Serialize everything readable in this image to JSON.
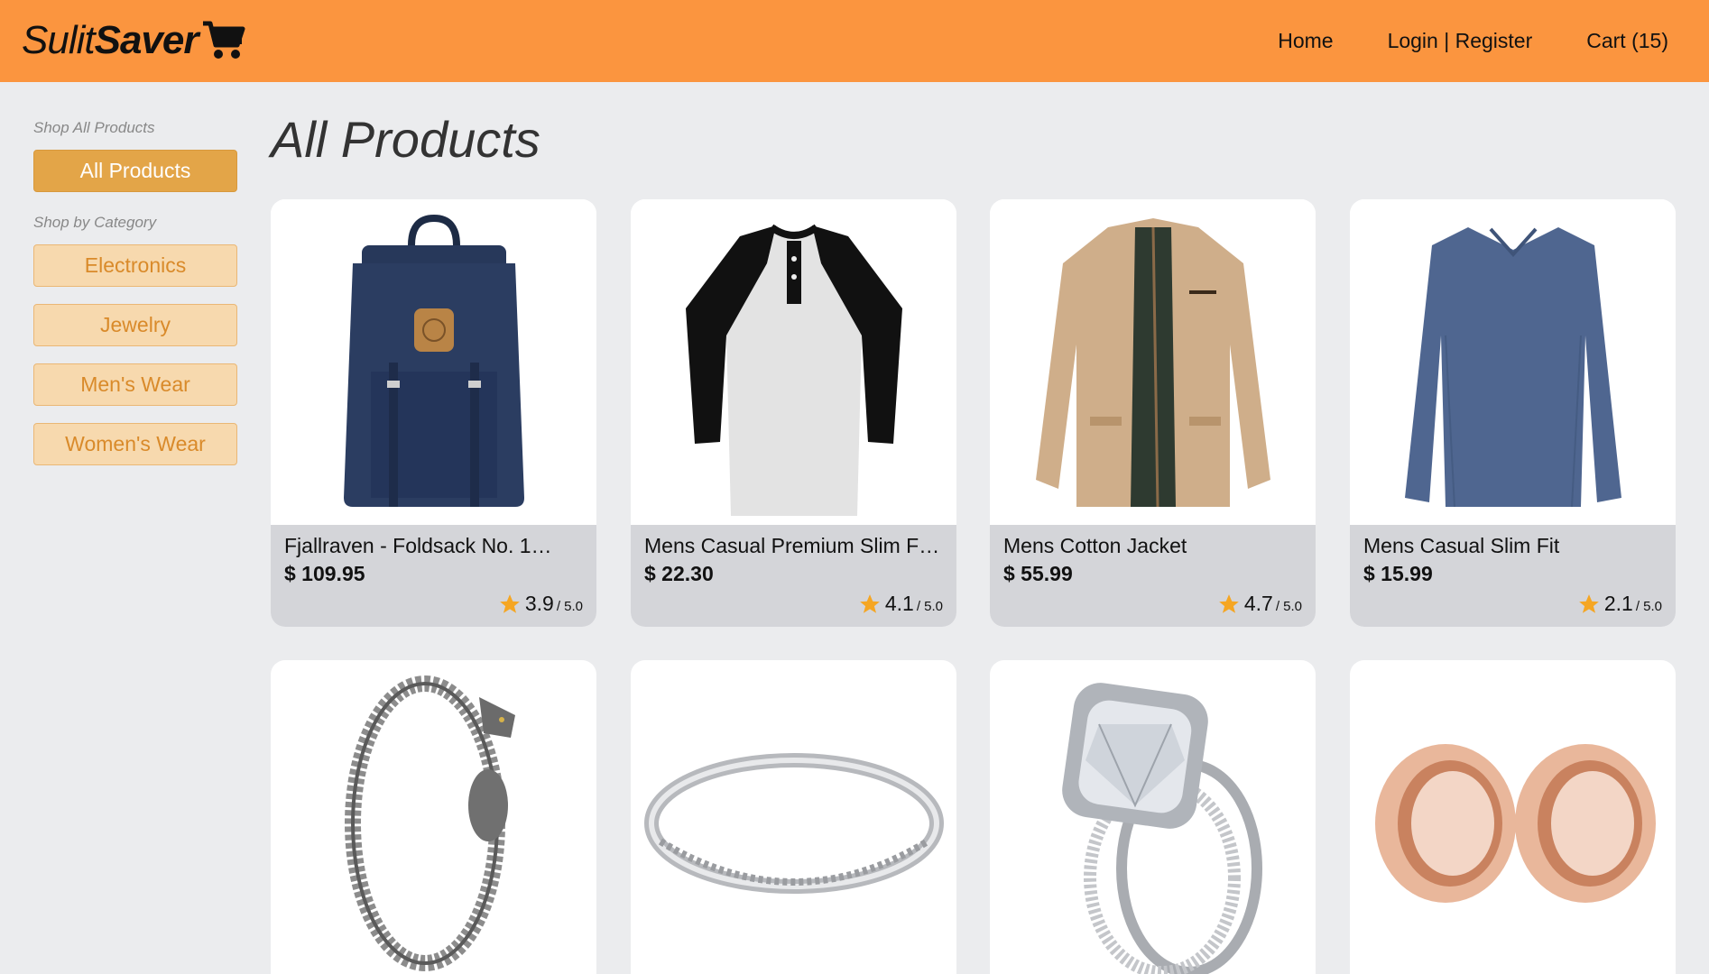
{
  "brand": {
    "part1": "Sulit",
    "part2": "Saver"
  },
  "nav": {
    "home": "Home",
    "login": "Login | Register",
    "cart": "Cart (15)"
  },
  "sidebar": {
    "shop_all_heading": "Shop All Products",
    "all_products": "All Products",
    "shop_by_category_heading": "Shop by Category",
    "categories": [
      "Electronics",
      "Jewelry",
      "Men's Wear",
      "Women's Wear"
    ]
  },
  "page_title": "All Products",
  "products": [
    {
      "name": "Fjallraven - Foldsack No. 1…",
      "price": "$ 109.95",
      "rating": "3.9",
      "rating_max": "/ 5.0",
      "image": "backpack"
    },
    {
      "name": "Mens Casual Premium Slim Fit…",
      "price": "$ 22.30",
      "rating": "4.1",
      "rating_max": "/ 5.0",
      "image": "raglan-tshirt"
    },
    {
      "name": "Mens Cotton Jacket",
      "price": "$ 55.99",
      "rating": "4.7",
      "rating_max": "/ 5.0",
      "image": "jacket"
    },
    {
      "name": "Mens Casual Slim Fit",
      "price": "$ 15.99",
      "rating": "2.1",
      "rating_max": "/ 5.0",
      "image": "long-sleeve-shirt"
    },
    {
      "image": "dragon-bracelet"
    },
    {
      "image": "silver-ring"
    },
    {
      "image": "diamond-ring-set"
    },
    {
      "image": "rose-gold-plugs"
    }
  ],
  "colors": {
    "header": "#fb953f",
    "accent": "#e3a548",
    "category_bg": "#f7d9ae",
    "category_text": "#d98a2a",
    "star": "#f5a623"
  }
}
